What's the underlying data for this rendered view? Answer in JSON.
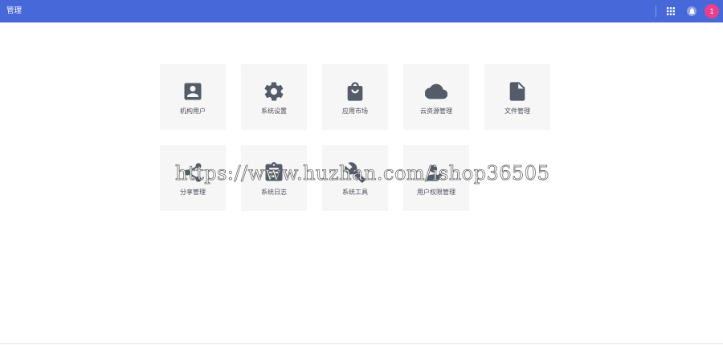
{
  "header": {
    "title": "管理",
    "accent_color": "#4668d8",
    "apps_icon": "apps-grid-icon",
    "notification_icon": "bell-icon",
    "avatar_text": "1",
    "avatar_color": "#ea3f8c"
  },
  "tiles": [
    {
      "label": "机构用户",
      "icon": "account-box-icon"
    },
    {
      "label": "系统设置",
      "icon": "gear-icon"
    },
    {
      "label": "应用市场",
      "icon": "shopping-bag-icon"
    },
    {
      "label": "云资源管理",
      "icon": "cloud-icon"
    },
    {
      "label": "文件管理",
      "icon": "file-icon"
    },
    {
      "label": "分享管理",
      "icon": "share-icon"
    },
    {
      "label": "系统日志",
      "icon": "clipboard-icon"
    },
    {
      "label": "系统工具",
      "icon": "wrench-icon"
    },
    {
      "label": "用户权限管理",
      "icon": "user-permission-icon"
    }
  ],
  "watermark": "https://www.huzhan.com/ishop36505"
}
